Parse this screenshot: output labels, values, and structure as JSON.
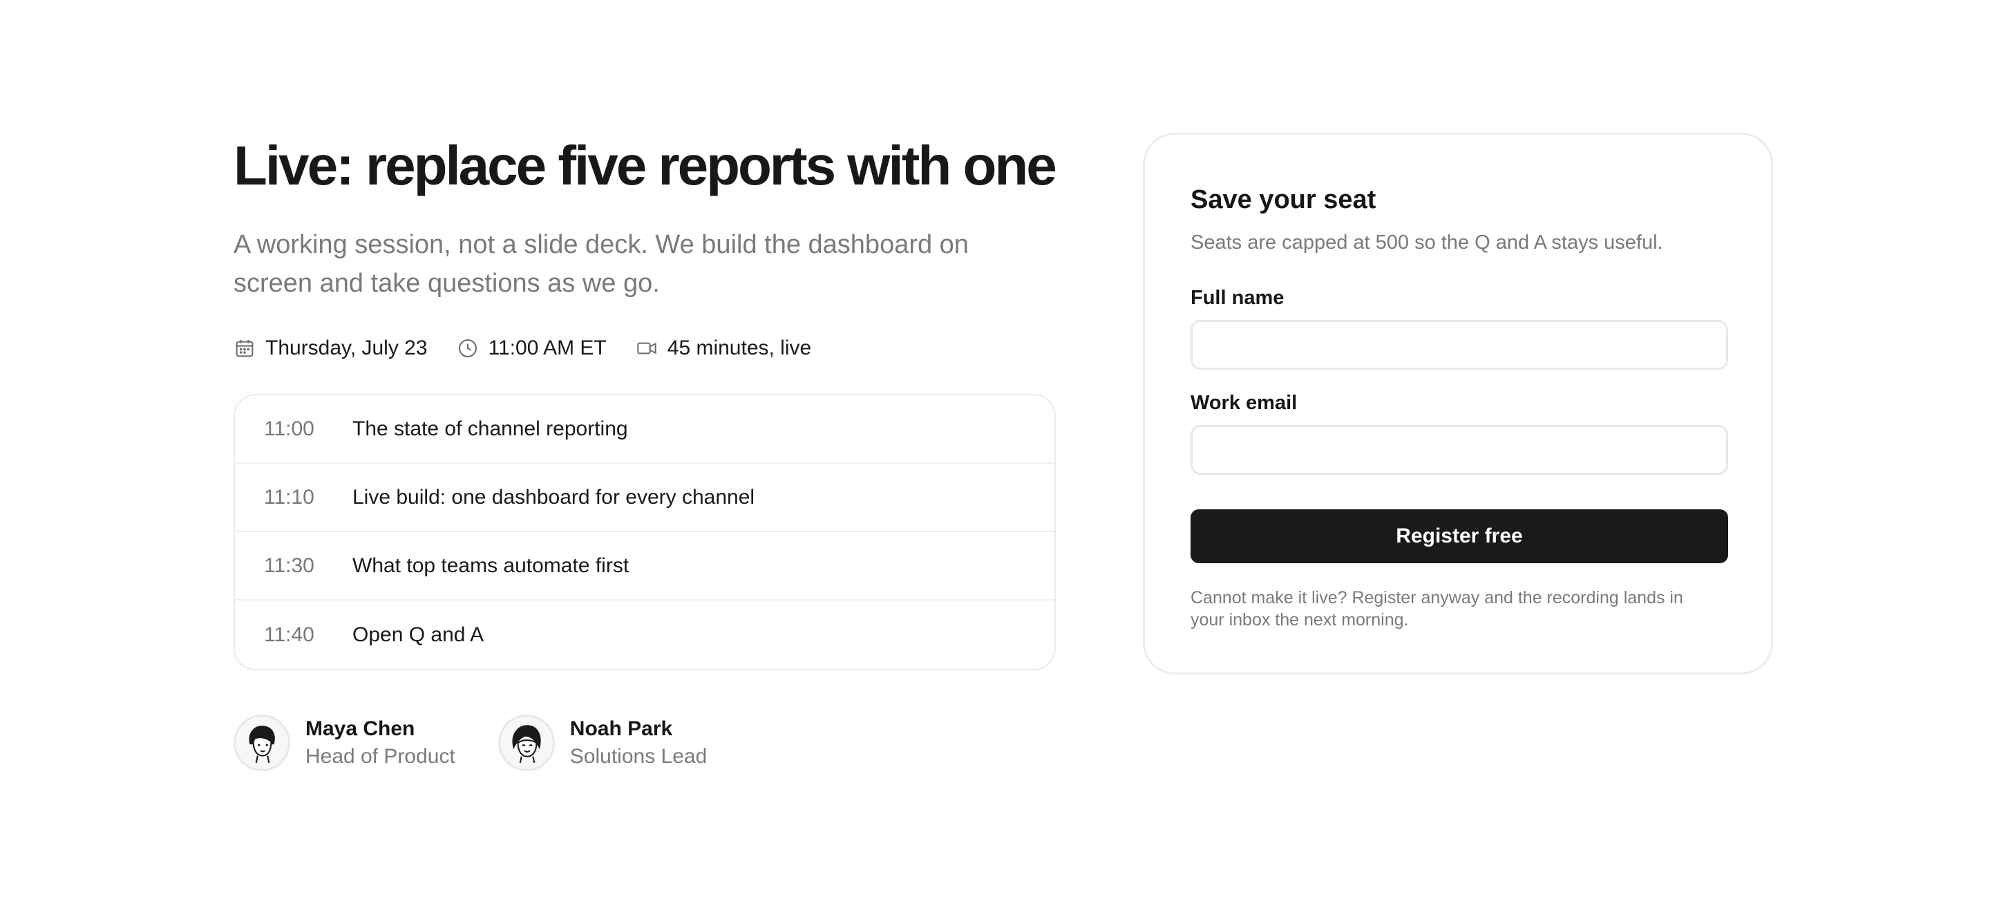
{
  "event": {
    "title": "Live: replace five reports with one",
    "subtitle": "A working session, not a slide deck. We build the dashboard on screen and take questions as we go.",
    "meta": [
      {
        "icon": "calendar-icon",
        "label": "Thursday, July 23"
      },
      {
        "icon": "clock-icon",
        "label": "11:00 AM ET"
      },
      {
        "icon": "video-icon",
        "label": "45 minutes, live"
      }
    ]
  },
  "agenda": [
    {
      "time": "11:00",
      "topic": "The state of channel reporting"
    },
    {
      "time": "11:10",
      "topic": "Live build: one dashboard for every channel"
    },
    {
      "time": "11:30",
      "topic": "What top teams automate first"
    },
    {
      "time": "11:40",
      "topic": "Open Q and A"
    }
  ],
  "speakers": [
    {
      "name": "Maya Chen",
      "role": "Head of Product"
    },
    {
      "name": "Noah Park",
      "role": "Solutions Lead"
    }
  ],
  "form": {
    "title": "Save your seat",
    "subtitle": "Seats are capped at 500 so the Q and A stays useful.",
    "name_label": "Full name",
    "name_value": "",
    "email_label": "Work email",
    "email_value": "",
    "submit_label": "Register free",
    "note": "Cannot make it live? Register anyway and the recording lands in your inbox the next morning."
  },
  "colors": {
    "button": "#1a1a1a",
    "muted_text": "#7a7a7a",
    "border": "#ececec"
  }
}
